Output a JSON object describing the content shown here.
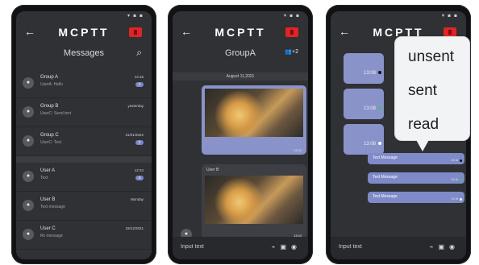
{
  "app": {
    "name": "MCPTT",
    "status_icons": "▾ ▪ ▪"
  },
  "screen1": {
    "title": "Messages",
    "groups": [
      {
        "name": "Group A",
        "sub": "UserA: Hello",
        "time": "13:16",
        "badge": "2"
      },
      {
        "name": "Group B",
        "sub": "UserC: Send text",
        "time": "yesterday",
        "badge": ""
      },
      {
        "name": "Group C",
        "sub": "UserC: Text",
        "time": "31/01/2022",
        "badge": "5"
      }
    ],
    "users": [
      {
        "name": "User A",
        "sub": "Text",
        "time": "12:34",
        "badge": "4"
      },
      {
        "name": "User B",
        "sub": "Text message",
        "time": "Monday",
        "badge": ""
      },
      {
        "name": "User C",
        "sub": "Rx message",
        "time": "19/12/2021",
        "badge": ""
      }
    ]
  },
  "screen2": {
    "title": "GroupA",
    "members": "+2",
    "date": "August 11,2021",
    "outgoing_time": "13:02",
    "incoming_sender": "User B",
    "incoming_time": "13:03",
    "input_placeholder": "Input text"
  },
  "screen3": {
    "clock_times": [
      "13:08",
      "13:08",
      "13:08"
    ],
    "messages": [
      {
        "text": "Text Message",
        "time": "13:16"
      },
      {
        "text": "Text Message",
        "time": "13:16"
      },
      {
        "text": "Text Message",
        "time": "13:16"
      }
    ],
    "input_placeholder": "Input text",
    "legend": [
      "unsent",
      "sent",
      "read"
    ]
  },
  "colors": {
    "unsent": "#111111",
    "sent": "#43c463",
    "read": "#ffffff",
    "accent": "#8a93c9",
    "brand_red": "#e02424"
  }
}
